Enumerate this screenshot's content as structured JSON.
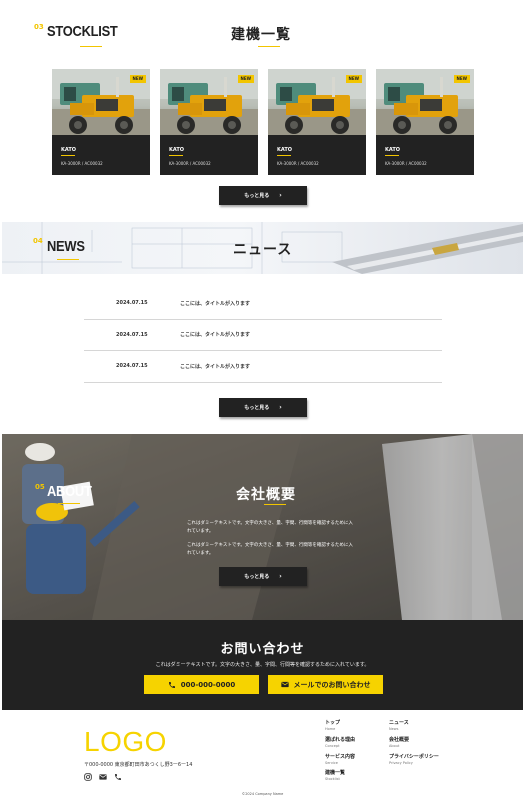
{
  "stocklist": {
    "num": "03",
    "title_en": "STOCKLIST",
    "title_jp": "建機一覧",
    "cards": [
      {
        "badge": "NEW",
        "maker": "KATO",
        "model": "KA-3000R / AC00032"
      },
      {
        "badge": "NEW",
        "maker": "KATO",
        "model": "KA-3000R / AC00032"
      },
      {
        "badge": "NEW",
        "maker": "KATO",
        "model": "KA-3000R / AC00032"
      },
      {
        "badge": "NEW",
        "maker": "KATO",
        "model": "KA-3000R / AC00032"
      }
    ],
    "more_label": "もっと見る",
    "more_arrow": "›"
  },
  "news": {
    "num": "04",
    "title_en": "NEWS",
    "title_jp": "ニュース",
    "items": [
      {
        "date": "2024.07.15",
        "title": "ここには、タイトルが入ります"
      },
      {
        "date": "2024.07.15",
        "title": "ここには、タイトルが入ります"
      },
      {
        "date": "2024.07.15",
        "title": "ここには、タイトルが入ります"
      }
    ],
    "more_label": "もっと見る",
    "more_arrow": "›"
  },
  "about": {
    "num": "05",
    "title_en": "ABOUT",
    "title_jp": "会社概要",
    "text1": "これはダミーテキストです。文字の大きさ、量、字間、行間等を確認するために入れています。",
    "text2": "これはダミーテキストです。文字の大きさ、量、字間、行間等を確認するために入れています。",
    "more_label": "もっと見る",
    "more_arrow": "›"
  },
  "contact": {
    "title": "お問い合わせ",
    "subtitle": "これはダミーテキストです。文字の大きさ、量、字間、行間等を確認するために入れています。",
    "phone_label": "000-000-0000",
    "mail_label": "メールでのお問い合わせ"
  },
  "footer": {
    "logo": "LOGO",
    "address": "〒000-0000 東京都町田市あつくし野3ー6ー14",
    "nav": [
      {
        "jp": "トップ",
        "en": "Home"
      },
      {
        "jp": "選ばれる理由",
        "en": "Concept"
      },
      {
        "jp": "サービス内容",
        "en": "Service"
      },
      {
        "jp": "建機一覧",
        "en": "Stocklist"
      },
      {
        "jp": "ニュース",
        "en": "News"
      },
      {
        "jp": "会社概要",
        "en": "About"
      },
      {
        "jp": "プライバシーポリシー",
        "en": "Privacy Policy"
      }
    ],
    "copyright": "©2024 Company Name"
  },
  "colors": {
    "accent": "#f2c500",
    "dark": "#222222"
  },
  "icons": [
    "phone-icon",
    "mail-icon",
    "instagram-icon"
  ]
}
